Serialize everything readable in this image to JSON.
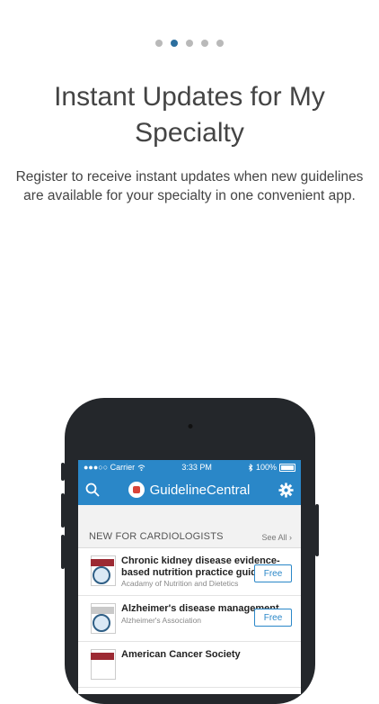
{
  "pager": {
    "count": 5,
    "active_index": 1
  },
  "headline": "Instant Updates for My Specialty",
  "subtext": "Register to receive instant updates when new guidelines are available for your specialty in one convenient app.",
  "device": {
    "status": {
      "carrier": "●●●○○ Carrier",
      "time": "3:33 PM",
      "battery": "100%"
    },
    "nav": {
      "title": "GuidelineCentral"
    },
    "section": {
      "title": "NEW FOR CARDIOLOGISTS",
      "see_all": "See All"
    },
    "items": [
      {
        "title": "Chronic kidney disease evidence-based nutrition practice guideline",
        "subtitle": "Acadamy of Nutrition and Dietetics",
        "button": "Free"
      },
      {
        "title": "Alzheimer's disease management",
        "subtitle": "Alzheimer's Association",
        "button": "Free"
      },
      {
        "title": "American Cancer Society",
        "subtitle": "",
        "button": ""
      }
    ]
  },
  "colors": {
    "brand_blue": "#2a87c8",
    "dot_active": "#2c6f9e",
    "dot_inactive": "#b9b9b9"
  }
}
